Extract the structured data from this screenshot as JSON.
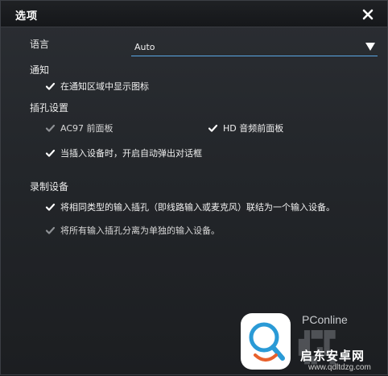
{
  "window": {
    "title": "选项"
  },
  "language": {
    "label": "语言",
    "value": "Auto"
  },
  "notify": {
    "heading": "通知",
    "show_icon": "在通知区域中显示图标"
  },
  "jack": {
    "heading": "插孔设置",
    "ac97": "AC97 前面板",
    "hd": "HD 音频前面板",
    "auto_popup": "当插入设备时，开启自动弹出对话框"
  },
  "recording": {
    "heading": "录制设备",
    "merge": "将相同类型的输入插孔（即线路输入或麦克风）联结为一个输入设备。",
    "separate": "将所有输入插孔分离为单独的输入设备。"
  },
  "watermark": {
    "brand": "PConline",
    "cn": "启东安卓网",
    "url": "www.qdltdzg.com"
  },
  "colors": {
    "accent": "#5aa8e6",
    "check_active": "#ffffff",
    "check_disabled": "#8e9195"
  }
}
